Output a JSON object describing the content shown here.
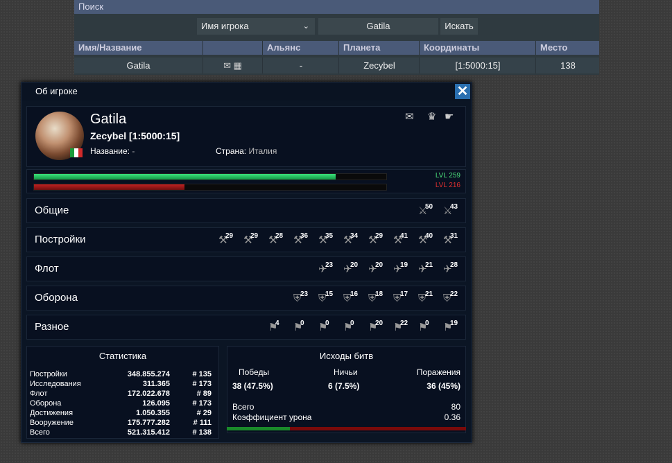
{
  "search": {
    "title": "Поиск",
    "select_value": "Имя игрока",
    "query": "Gatila",
    "button": "Искать",
    "columns": [
      "Имя/Название",
      "",
      "Альянс",
      "Планета",
      "Координаты",
      "Место"
    ],
    "row": {
      "name": "Gatila",
      "alliance": "-",
      "planet": "Zecybel",
      "coords": "[1:5000:15]",
      "rank": "138"
    }
  },
  "dialog": {
    "title": "Об игроке",
    "player": "Gatila",
    "planet": "Zecybel [1:5000:15]",
    "name_label": "Название:",
    "name_value": "-",
    "country_label": "Страна:",
    "country_value": "Италия",
    "lvl1": "LVL 259",
    "lvl2": "LVL 216",
    "bar1_fraction": 0.857,
    "bar2_fraction": 0.427,
    "categories": [
      {
        "label": "Общие",
        "values": [
          "50",
          "43"
        ]
      },
      {
        "label": "Постройки",
        "values": [
          "29",
          "29",
          "28",
          "36",
          "35",
          "34",
          "29",
          "41",
          "40",
          "31"
        ]
      },
      {
        "label": "Флот",
        "values": [
          "23",
          "20",
          "20",
          "19",
          "21",
          "28"
        ]
      },
      {
        "label": "Оборона",
        "values": [
          "23",
          "15",
          "16",
          "18",
          "17",
          "21",
          "22"
        ]
      },
      {
        "label": "Разное",
        "values": [
          "4",
          "0",
          "0",
          "0",
          "20",
          "22",
          "0",
          "19"
        ]
      }
    ],
    "stats": {
      "title": "Статистика",
      "rows": [
        {
          "label": "Постройки",
          "value": "348.855.274",
          "rank": "# 135"
        },
        {
          "label": "Исследования",
          "value": "311.365",
          "rank": "# 173"
        },
        {
          "label": "Флот",
          "value": "172.022.678",
          "rank": "# 89"
        },
        {
          "label": "Оборона",
          "value": "126.095",
          "rank": "# 173"
        },
        {
          "label": "Достижения",
          "value": "1.050.355",
          "rank": "# 29"
        },
        {
          "label": "Вооружение",
          "value": "175.777.282",
          "rank": "# 111"
        },
        {
          "label": "Всего",
          "value": "521.315.412",
          "rank": "# 138"
        }
      ]
    },
    "battles": {
      "title": "Исходы битв",
      "wins_label": "Победы",
      "wins": "38 (47.5%)",
      "draws_label": "Ничьи",
      "draws": "6 (7.5%)",
      "losses_label": "Поражения",
      "losses": "36 (45%)",
      "total_label": "Всего",
      "total": "80",
      "coef_label": "Коэффициент урона",
      "coef": "0.36",
      "win_fraction": 0.265
    }
  }
}
